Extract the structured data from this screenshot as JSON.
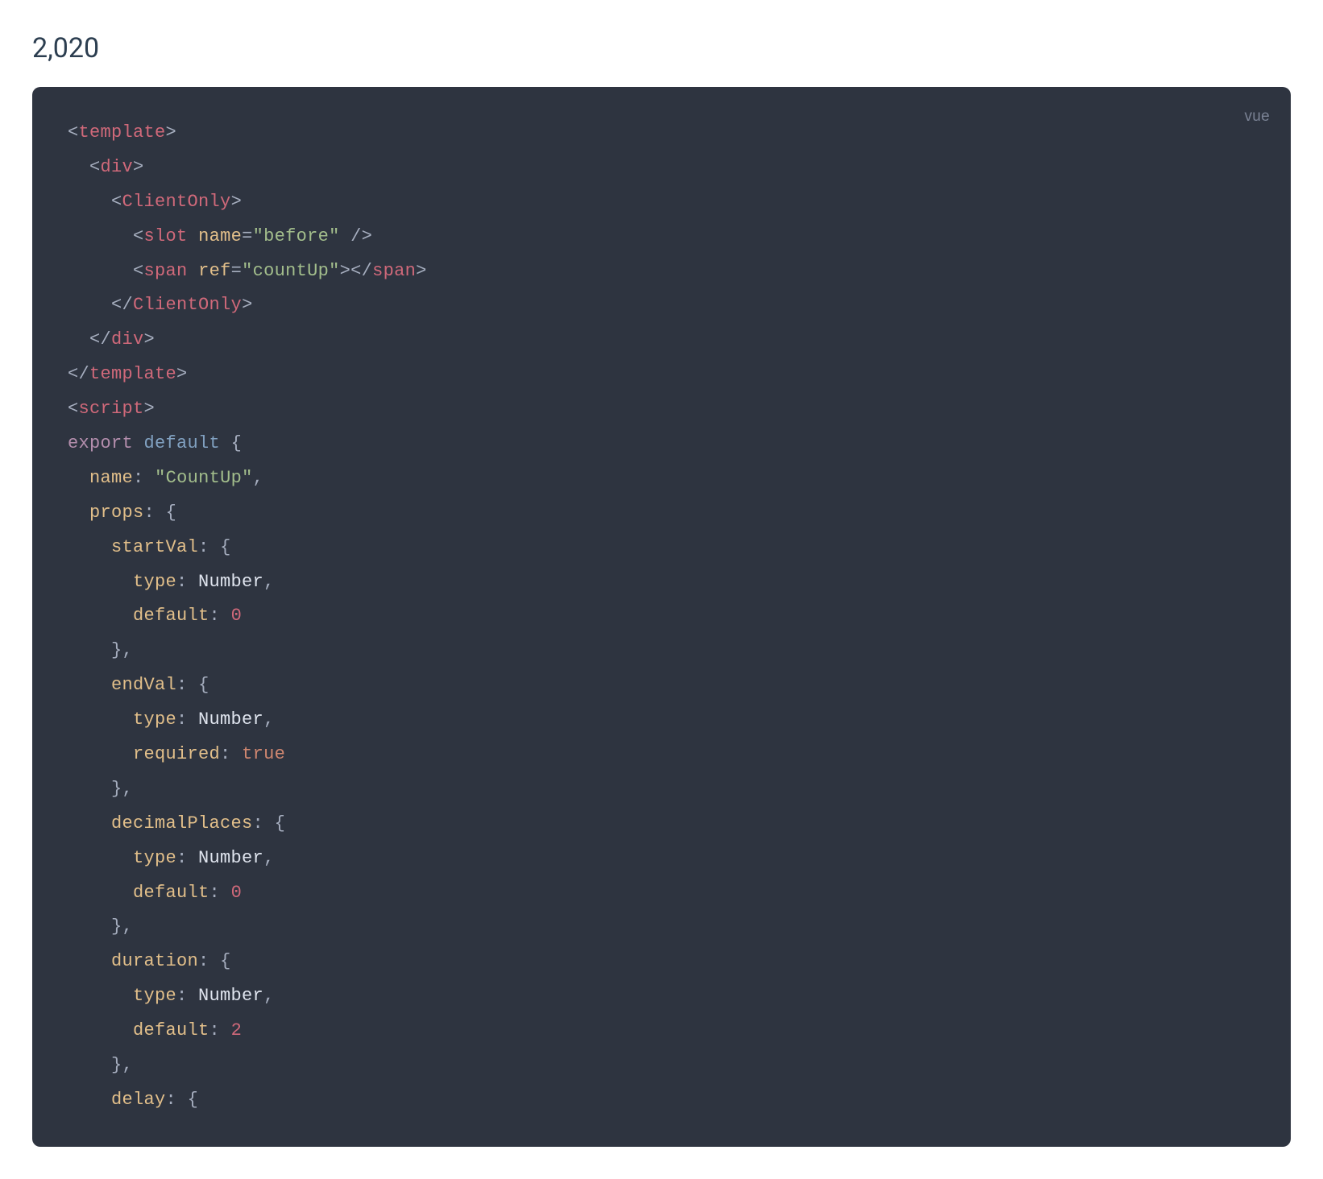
{
  "header": {
    "count_value": "2,020"
  },
  "code": {
    "language_label": "vue",
    "lines": [
      [
        {
          "t": "bracket",
          "v": "<"
        },
        {
          "t": "tag",
          "v": "template"
        },
        {
          "t": "bracket",
          "v": ">"
        }
      ],
      [
        {
          "t": "plain",
          "v": "  "
        },
        {
          "t": "bracket",
          "v": "<"
        },
        {
          "t": "tag",
          "v": "div"
        },
        {
          "t": "bracket",
          "v": ">"
        }
      ],
      [
        {
          "t": "plain",
          "v": "    "
        },
        {
          "t": "bracket",
          "v": "<"
        },
        {
          "t": "tag",
          "v": "ClientOnly"
        },
        {
          "t": "bracket",
          "v": ">"
        }
      ],
      [
        {
          "t": "plain",
          "v": "      "
        },
        {
          "t": "bracket",
          "v": "<"
        },
        {
          "t": "tag",
          "v": "slot"
        },
        {
          "t": "plain",
          "v": " "
        },
        {
          "t": "attr-name",
          "v": "name"
        },
        {
          "t": "attr-eq",
          "v": "="
        },
        {
          "t": "string",
          "v": "\"before\""
        },
        {
          "t": "plain",
          "v": " "
        },
        {
          "t": "bracket",
          "v": "/>"
        }
      ],
      [
        {
          "t": "plain",
          "v": "      "
        },
        {
          "t": "bracket",
          "v": "<"
        },
        {
          "t": "tag",
          "v": "span"
        },
        {
          "t": "plain",
          "v": " "
        },
        {
          "t": "attr-name",
          "v": "ref"
        },
        {
          "t": "attr-eq",
          "v": "="
        },
        {
          "t": "string",
          "v": "\"countUp\""
        },
        {
          "t": "bracket",
          "v": "></"
        },
        {
          "t": "tag",
          "v": "span"
        },
        {
          "t": "bracket",
          "v": ">"
        }
      ],
      [
        {
          "t": "plain",
          "v": "    "
        },
        {
          "t": "bracket",
          "v": "</"
        },
        {
          "t": "tag",
          "v": "ClientOnly"
        },
        {
          "t": "bracket",
          "v": ">"
        }
      ],
      [
        {
          "t": "plain",
          "v": "  "
        },
        {
          "t": "bracket",
          "v": "</"
        },
        {
          "t": "tag",
          "v": "div"
        },
        {
          "t": "bracket",
          "v": ">"
        }
      ],
      [
        {
          "t": "bracket",
          "v": "</"
        },
        {
          "t": "tag",
          "v": "template"
        },
        {
          "t": "bracket",
          "v": ">"
        }
      ],
      [
        {
          "t": "bracket",
          "v": "<"
        },
        {
          "t": "tag",
          "v": "script"
        },
        {
          "t": "bracket",
          "v": ">"
        }
      ],
      [
        {
          "t": "keyword",
          "v": "export"
        },
        {
          "t": "plain",
          "v": " "
        },
        {
          "t": "default-kw",
          "v": "default"
        },
        {
          "t": "plain",
          "v": " "
        },
        {
          "t": "punct",
          "v": "{"
        }
      ],
      [
        {
          "t": "plain",
          "v": "  "
        },
        {
          "t": "property",
          "v": "name"
        },
        {
          "t": "punct",
          "v": ":"
        },
        {
          "t": "plain",
          "v": " "
        },
        {
          "t": "string",
          "v": "\"CountUp\""
        },
        {
          "t": "punct",
          "v": ","
        }
      ],
      [
        {
          "t": "plain",
          "v": "  "
        },
        {
          "t": "property",
          "v": "props"
        },
        {
          "t": "punct",
          "v": ":"
        },
        {
          "t": "plain",
          "v": " "
        },
        {
          "t": "punct",
          "v": "{"
        }
      ],
      [
        {
          "t": "plain",
          "v": "    "
        },
        {
          "t": "property",
          "v": "startVal"
        },
        {
          "t": "punct",
          "v": ":"
        },
        {
          "t": "plain",
          "v": " "
        },
        {
          "t": "punct",
          "v": "{"
        }
      ],
      [
        {
          "t": "plain",
          "v": "      "
        },
        {
          "t": "property",
          "v": "type"
        },
        {
          "t": "punct",
          "v": ":"
        },
        {
          "t": "plain",
          "v": " Number"
        },
        {
          "t": "punct",
          "v": ","
        }
      ],
      [
        {
          "t": "plain",
          "v": "      "
        },
        {
          "t": "property",
          "v": "default"
        },
        {
          "t": "punct",
          "v": ":"
        },
        {
          "t": "plain",
          "v": " "
        },
        {
          "t": "number",
          "v": "0"
        }
      ],
      [
        {
          "t": "plain",
          "v": "    "
        },
        {
          "t": "punct",
          "v": "},"
        }
      ],
      [
        {
          "t": "plain",
          "v": "    "
        },
        {
          "t": "property",
          "v": "endVal"
        },
        {
          "t": "punct",
          "v": ":"
        },
        {
          "t": "plain",
          "v": " "
        },
        {
          "t": "punct",
          "v": "{"
        }
      ],
      [
        {
          "t": "plain",
          "v": "      "
        },
        {
          "t": "property",
          "v": "type"
        },
        {
          "t": "punct",
          "v": ":"
        },
        {
          "t": "plain",
          "v": " Number"
        },
        {
          "t": "punct",
          "v": ","
        }
      ],
      [
        {
          "t": "plain",
          "v": "      "
        },
        {
          "t": "property",
          "v": "required"
        },
        {
          "t": "punct",
          "v": ":"
        },
        {
          "t": "plain",
          "v": " "
        },
        {
          "t": "bool",
          "v": "true"
        }
      ],
      [
        {
          "t": "plain",
          "v": "    "
        },
        {
          "t": "punct",
          "v": "},"
        }
      ],
      [
        {
          "t": "plain",
          "v": "    "
        },
        {
          "t": "property",
          "v": "decimalPlaces"
        },
        {
          "t": "punct",
          "v": ":"
        },
        {
          "t": "plain",
          "v": " "
        },
        {
          "t": "punct",
          "v": "{"
        }
      ],
      [
        {
          "t": "plain",
          "v": "      "
        },
        {
          "t": "property",
          "v": "type"
        },
        {
          "t": "punct",
          "v": ":"
        },
        {
          "t": "plain",
          "v": " Number"
        },
        {
          "t": "punct",
          "v": ","
        }
      ],
      [
        {
          "t": "plain",
          "v": "      "
        },
        {
          "t": "property",
          "v": "default"
        },
        {
          "t": "punct",
          "v": ":"
        },
        {
          "t": "plain",
          "v": " "
        },
        {
          "t": "number",
          "v": "0"
        }
      ],
      [
        {
          "t": "plain",
          "v": "    "
        },
        {
          "t": "punct",
          "v": "},"
        }
      ],
      [
        {
          "t": "plain",
          "v": "    "
        },
        {
          "t": "property",
          "v": "duration"
        },
        {
          "t": "punct",
          "v": ":"
        },
        {
          "t": "plain",
          "v": " "
        },
        {
          "t": "punct",
          "v": "{"
        }
      ],
      [
        {
          "t": "plain",
          "v": "      "
        },
        {
          "t": "property",
          "v": "type"
        },
        {
          "t": "punct",
          "v": ":"
        },
        {
          "t": "plain",
          "v": " Number"
        },
        {
          "t": "punct",
          "v": ","
        }
      ],
      [
        {
          "t": "plain",
          "v": "      "
        },
        {
          "t": "property",
          "v": "default"
        },
        {
          "t": "punct",
          "v": ":"
        },
        {
          "t": "plain",
          "v": " "
        },
        {
          "t": "number",
          "v": "2"
        }
      ],
      [
        {
          "t": "plain",
          "v": "    "
        },
        {
          "t": "punct",
          "v": "},"
        }
      ],
      [
        {
          "t": "plain",
          "v": "    "
        },
        {
          "t": "property",
          "v": "delay"
        },
        {
          "t": "punct",
          "v": ":"
        },
        {
          "t": "plain",
          "v": " "
        },
        {
          "t": "punct",
          "v": "{"
        }
      ]
    ]
  }
}
